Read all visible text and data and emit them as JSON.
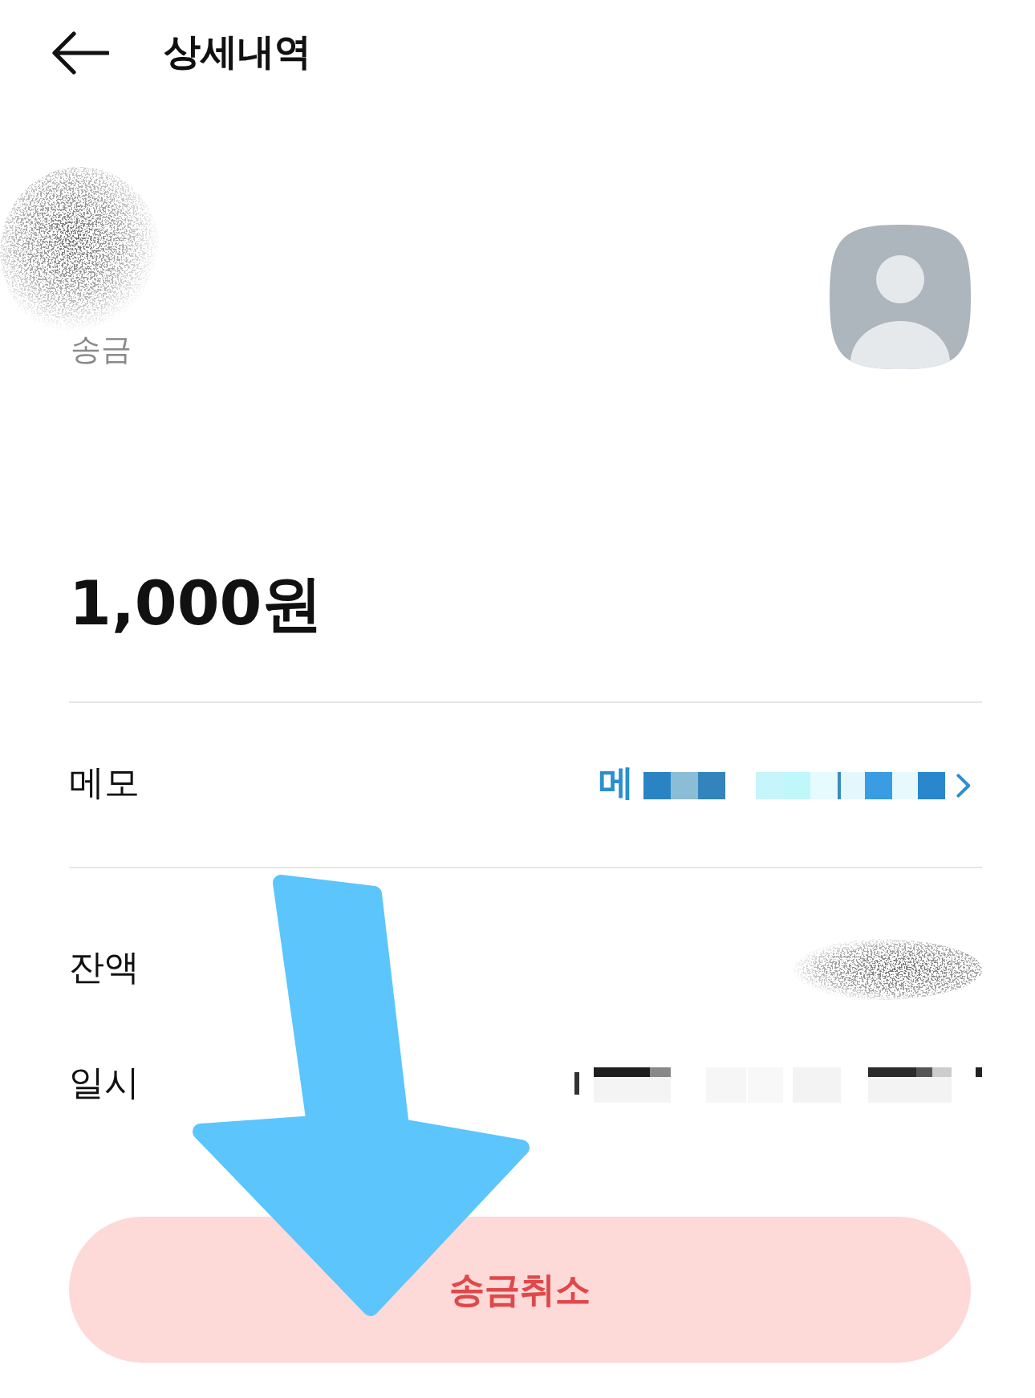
{
  "header": {
    "title": "상세내역"
  },
  "counterparty": {
    "type_label": "송금"
  },
  "amount": "1,000원",
  "details": [
    {
      "kind": "link",
      "label": "메모",
      "value": "메"
    },
    {
      "kind": "blurred",
      "label": "잔액"
    },
    {
      "kind": "pixelated",
      "label": "일시"
    }
  ],
  "button": {
    "label": "송금취소"
  }
}
